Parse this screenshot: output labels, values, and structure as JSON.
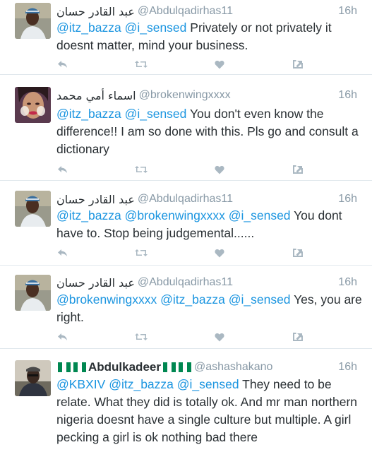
{
  "colors": {
    "mention": "#1b95e0",
    "meta": "#8899a6",
    "text": "#292f33",
    "icons": "#aab8c2",
    "flag_green": "#008751"
  },
  "icons": [
    "reply-icon",
    "retweet-icon",
    "like-icon",
    "more-icon",
    "nigeria-flag-emoji"
  ],
  "tweets": [
    {
      "name": "عبد القادر حسان",
      "handle": "@Abdulqadirhas11",
      "time": "16h",
      "mentions": [
        "@itz_bazza",
        "@i_sensed"
      ],
      "body": " Privately or not privately it doesnt matter, mind your business."
    },
    {
      "name": "اسماء أمي محمد",
      "handle": "@brokenwingxxxx",
      "time": "16h",
      "mentions": [
        "@itz_bazza",
        "@i_sensed"
      ],
      "body": " You don't even know the difference!! I am so done with this. Pls go and consult a dictionary"
    },
    {
      "name": "عبد القادر حسان",
      "handle": "@Abdulqadirhas11",
      "time": "16h",
      "mentions": [
        "@itz_bazza",
        "@brokenwingxxxx",
        "@i_sensed"
      ],
      "body": " You dont have to. Stop being judgemental......"
    },
    {
      "name": "عبد القادر حسان",
      "handle": "@Abdulqadirhas11",
      "time": "16h",
      "mentions": [
        "@brokenwingxxxx",
        "@itz_bazza",
        "@i_sensed"
      ],
      "body": " Yes, you are right."
    },
    {
      "name": "Abdulkadeer",
      "handle": "@ashashakano",
      "time": "16h",
      "mentions": [
        "@KBXIV",
        "@itz_bazza",
        "@i_sensed"
      ],
      "body": " They need to be relate. What they did is totally ok. And mr man northern nigeria doesnt have a single culture but multiple. A girl pecking a girl is ok nothing bad there"
    }
  ]
}
